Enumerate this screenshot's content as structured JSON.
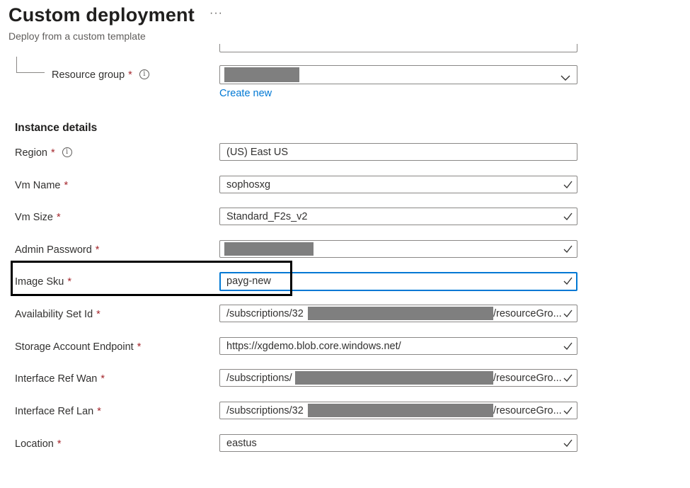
{
  "header": {
    "title": "Custom deployment",
    "subtitle": "Deploy from a custom template",
    "more_label": "···"
  },
  "resource_group": {
    "label": "Resource group",
    "required_mark": "*",
    "create_new_label": "Create new"
  },
  "instance_details": {
    "heading": "Instance details"
  },
  "fields": {
    "region": {
      "label": "Region",
      "value": "(US) East US"
    },
    "vm_name": {
      "label": "Vm Name",
      "value": "sophosxg"
    },
    "vm_size": {
      "label": "Vm Size",
      "value": "Standard_F2s_v2"
    },
    "admin_password": {
      "label": "Admin Password",
      "value": ""
    },
    "image_sku": {
      "label": "Image Sku",
      "value": "payg-new"
    },
    "availability_set": {
      "label": "Availability Set Id",
      "value_prefix": "/subscriptions/32",
      "value_suffix": "/resourceGro..."
    },
    "storage_endpoint": {
      "label": "Storage Account Endpoint",
      "value": "https://xgdemo.blob.core.windows.net/"
    },
    "interface_wan": {
      "label": "Interface Ref Wan",
      "value_prefix": "/subscriptions/",
      "value_suffix": "/resourceGro..."
    },
    "interface_lan": {
      "label": "Interface Ref Lan",
      "value_prefix": "/subscriptions/32",
      "value_suffix": "/resourceGro..."
    },
    "location": {
      "label": "Location",
      "value": "eastus"
    }
  },
  "required_mark": "*",
  "colors": {
    "accent": "#0078d4",
    "required": "#a4262c",
    "redaction": "#7f7f7f",
    "highlight": "#000000"
  }
}
